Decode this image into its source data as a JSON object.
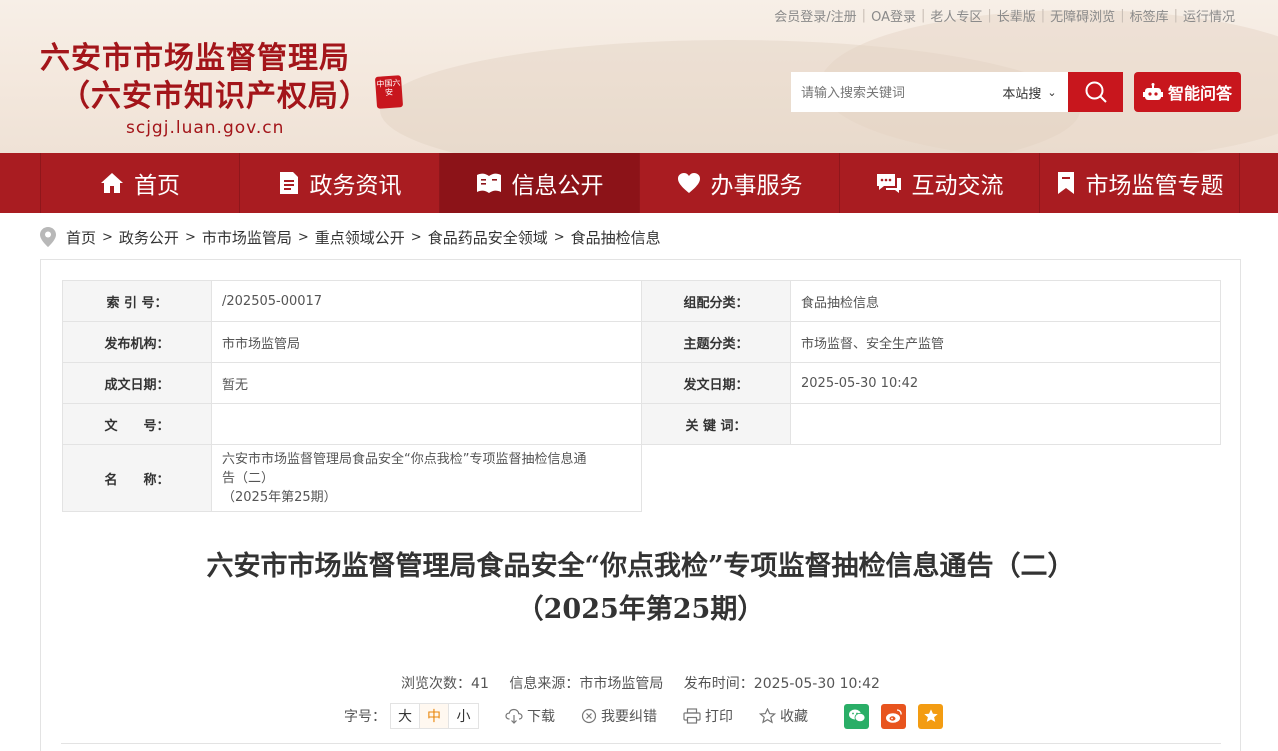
{
  "top_links": [
    "会员登录/注册",
    "OA登录",
    "老人专区",
    "长辈版",
    "无障碍浏览",
    "标签库",
    "运行情况"
  ],
  "logo": {
    "title_line1": "六安市市场监督管理局",
    "title_line2": "（六安市知识产权局）",
    "url": "scjgj.luan.gov.cn",
    "seal_text": "中国六安"
  },
  "search": {
    "placeholder": "请输入搜索关键词",
    "scope": "本站搜",
    "button_icon": "search-icon"
  },
  "ai_button": {
    "label": "智能问答",
    "icon": "robot-icon"
  },
  "nav": [
    {
      "label": "首页",
      "icon": "home-icon"
    },
    {
      "label": "政务资讯",
      "icon": "document-icon"
    },
    {
      "label": "信息公开",
      "icon": "book-icon",
      "active": true
    },
    {
      "label": "办事服务",
      "icon": "heart-icon"
    },
    {
      "label": "互动交流",
      "icon": "chat-icon"
    },
    {
      "label": "市场监管专题",
      "icon": "bookmark-icon"
    }
  ],
  "breadcrumb": [
    "首页",
    "政务公开",
    "市市场监管局",
    "重点领域公开",
    "食品药品安全领域",
    "食品抽检信息"
  ],
  "meta": {
    "index_label": "索 引 号：",
    "index_value": "/202505-00017",
    "category_label": "组配分类：",
    "category_value": "食品抽检信息",
    "publisher_label": "发布机构：",
    "publisher_value": "市市场监管局",
    "topic_label": "主题分类：",
    "topic_value": "市场监督、安全生产监管",
    "written_label": "成文日期：",
    "written_value": "暂无",
    "issued_label": "发文日期：",
    "issued_value": "2025-05-30 10:42",
    "docno_label": "文　　号：",
    "docno_value": "",
    "keywords_label": "关 键 词：",
    "keywords_value": "",
    "name_label": "名　　称：",
    "name_value_line1": "六安市市场监督管理局食品安全“你点我检”专项监督抽检信息通",
    "name_value_line2": "告（二）",
    "name_value_line3": "（2025年第25期）"
  },
  "article": {
    "title_line1": "六安市市场监督管理局食品安全“你点我检”专项监督抽检信息通告（二）",
    "title_line2": "（2025年第25期）",
    "views": "浏览次数：41",
    "source": "信息来源：市市场监管局",
    "published": "发布时间：2025-05-30 10:42"
  },
  "tools": {
    "font_size_label": "字号：",
    "font_sizes": [
      "大",
      "中",
      "小"
    ],
    "active_font_size": "中",
    "download": "下载",
    "report_error": "我要纠错",
    "print": "打印",
    "favorite": "收藏"
  },
  "colors": {
    "brand_red": "#a91c21",
    "button_red": "#c8161d",
    "wechat": "#2aae67",
    "weibo": "#e8541e",
    "star": "#f39c12"
  }
}
